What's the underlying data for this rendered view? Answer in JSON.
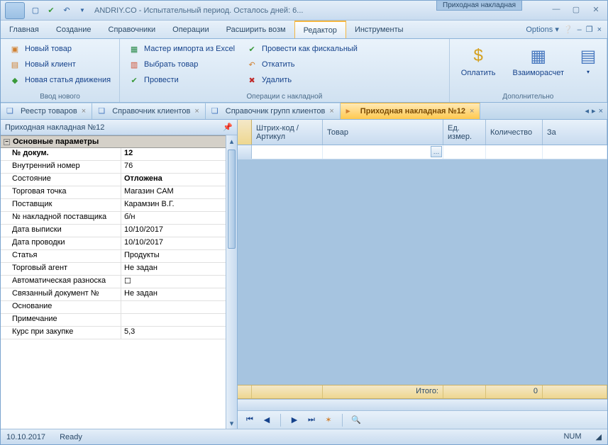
{
  "title": {
    "app": "ANDRIY.CO - Испытательный период. Осталось дней: 6...",
    "context": "Приходная накладная"
  },
  "menu": {
    "items": [
      "Главная",
      "Создание",
      "Справочники",
      "Операции",
      "Расширить возм",
      "Редактор",
      "Инструменты"
    ],
    "active": 5,
    "options": "Options"
  },
  "ribbon": {
    "group1": {
      "label": "Ввод нового",
      "items": [
        "Новый товар",
        "Новый клиент",
        "Новая статья движения"
      ]
    },
    "group2": {
      "label": "Операции с накладной",
      "col1": [
        "Мастер импорта из Excel",
        "Выбрать товар",
        "Провести"
      ],
      "col2": [
        "Провести как фискальный",
        "Откатить",
        "Удалить"
      ]
    },
    "group3": {
      "label": "Дополнительно",
      "items": [
        "Оплатить",
        "Взаиморасчет"
      ]
    }
  },
  "doctabs": [
    {
      "label": "Реестр товаров",
      "active": false
    },
    {
      "label": "Справочник клиентов",
      "active": false
    },
    {
      "label": "Справочник групп клиентов",
      "active": false
    },
    {
      "label": "Приходная накладная №12",
      "active": true
    }
  ],
  "panel": {
    "title": "Приходная накладная №12",
    "group": "Основные параметры",
    "rows": [
      {
        "label": "№ докум.",
        "value": "12",
        "bold": true
      },
      {
        "label": "Внутренний номер",
        "value": "76"
      },
      {
        "label": "Состояние",
        "value": "Отложена",
        "bold_value": true
      },
      {
        "label": "Торговая точка",
        "value": "Магазин САМ"
      },
      {
        "label": "Поставщик",
        "value": "Карамзин В.Г."
      },
      {
        "label": "№ накладной поставщика",
        "value": "б/н"
      },
      {
        "label": "Дата выписки",
        "value": "10/10/2017"
      },
      {
        "label": "Дата проводки",
        "value": "10/10/2017"
      },
      {
        "label": "Статья",
        "value": "Продукты"
      },
      {
        "label": "Торговый агент",
        "value": "Не задан"
      },
      {
        "label": "Автоматическая разноска",
        "value": "",
        "checkbox": true
      },
      {
        "label": "Связанный документ №",
        "value": "Не задан"
      },
      {
        "label": "Основание",
        "value": ""
      },
      {
        "label": "Примечание",
        "value": ""
      },
      {
        "label": "Курс при закупке",
        "value": "5,3"
      }
    ]
  },
  "grid": {
    "columns": [
      "Штрих-код / Артикул",
      "Товар",
      "Ед. измер.",
      "Количество",
      "За"
    ],
    "widths": [
      100,
      170,
      60,
      80,
      30
    ],
    "footer_label": "Итого:",
    "footer_qty": "0"
  },
  "status": {
    "date": "10.10.2017",
    "state": "Ready",
    "num": "NUM"
  }
}
